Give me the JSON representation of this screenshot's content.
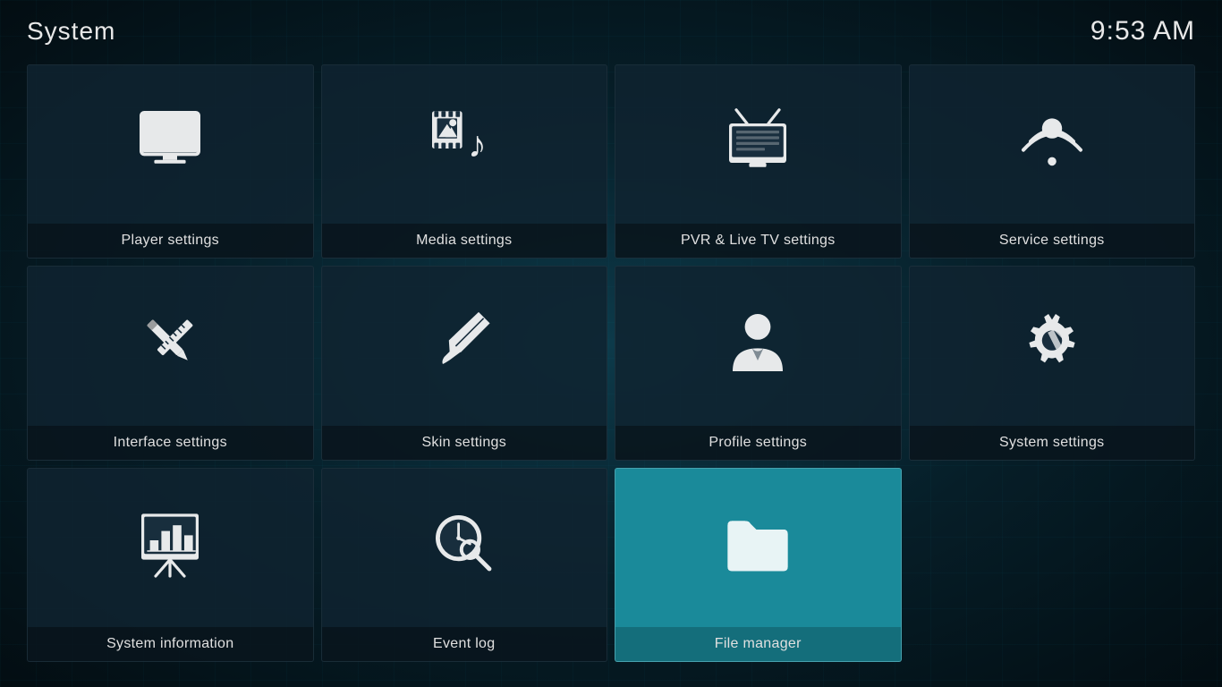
{
  "header": {
    "title": "System",
    "clock": "9:53 AM"
  },
  "grid": {
    "items": [
      {
        "id": "player-settings",
        "label": "Player settings",
        "icon": "player",
        "active": false
      },
      {
        "id": "media-settings",
        "label": "Media settings",
        "icon": "media",
        "active": false
      },
      {
        "id": "pvr-settings",
        "label": "PVR & Live TV settings",
        "icon": "pvr",
        "active": false
      },
      {
        "id": "service-settings",
        "label": "Service settings",
        "icon": "service",
        "active": false
      },
      {
        "id": "interface-settings",
        "label": "Interface settings",
        "icon": "interface",
        "active": false
      },
      {
        "id": "skin-settings",
        "label": "Skin settings",
        "icon": "skin",
        "active": false
      },
      {
        "id": "profile-settings",
        "label": "Profile settings",
        "icon": "profile",
        "active": false
      },
      {
        "id": "system-settings",
        "label": "System settings",
        "icon": "system",
        "active": false
      },
      {
        "id": "system-information",
        "label": "System information",
        "icon": "sysinfo",
        "active": false
      },
      {
        "id": "event-log",
        "label": "Event log",
        "icon": "eventlog",
        "active": false
      },
      {
        "id": "file-manager",
        "label": "File manager",
        "icon": "filemanager",
        "active": true
      }
    ],
    "accent_color": "#1a8a9a"
  }
}
